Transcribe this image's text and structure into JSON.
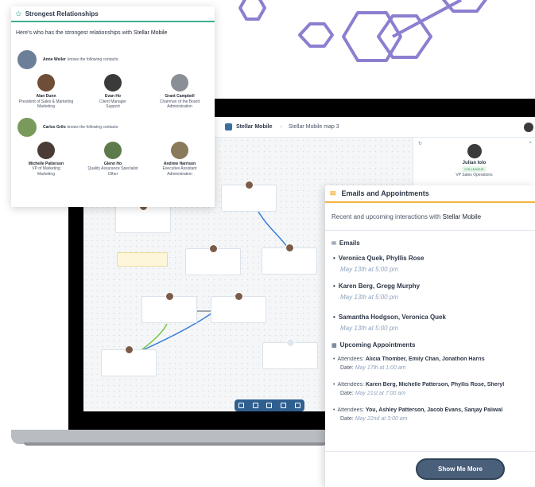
{
  "relationships": {
    "title": "Strongest Relationships",
    "intro_prefix": "Here's who has the strongest relationships with ",
    "company": "Stellar Mobile",
    "knows_suffix": "knows the following contacts:",
    "groups": [
      {
        "name": "Anne Weiler",
        "contacts": [
          {
            "name": "Alan Dunn",
            "title": "President of Sales & Marketing",
            "dept": "Marketing"
          },
          {
            "name": "Evan Ho",
            "title": "Client Manager",
            "dept": "Support"
          },
          {
            "name": "Grant Campbell",
            "title": "Chairman of the Board",
            "dept": "Administration"
          }
        ]
      },
      {
        "name": "Carlos Grilo",
        "contacts": [
          {
            "name": "Michelle Patterson",
            "title": "VP of Marketing",
            "dept": "Marketing"
          },
          {
            "name": "Glenn Ho",
            "title": "Quality Assurance Specialist",
            "dept": "Other"
          },
          {
            "name": "Andrew Harrison",
            "title": "Executive Assistant",
            "dept": "Administration"
          }
        ]
      }
    ]
  },
  "app": {
    "title": "Stellar Mobile",
    "map_name": "Stellar Mobile map 3",
    "profile": {
      "name": "Julian Iolo",
      "badge": "COLLEAGUE",
      "role": "VP Sales Operations"
    }
  },
  "emails_panel": {
    "title": "Emails and Appointments",
    "subtitle_prefix": "Recent and upcoming interactions with ",
    "company": "Stellar Mobile",
    "emails_title": "Emails",
    "emails": [
      {
        "names": "Veronica Quek, Phyllis Rose",
        "date": "May 13th at 5:00 pm"
      },
      {
        "names": "Karen Berg, Gregg Murphy",
        "date": "May 13th at 5:00 pm"
      },
      {
        "names": "Samantha Hodgson, Veronica Quek",
        "date": "May 13th at 5:00 pm"
      }
    ],
    "appointments_title": "Upcoming Appointments",
    "attendees_label": "Attendees:",
    "date_label": "Date:",
    "appointments": [
      {
        "attendees": "Alicia Thomber, Emily Chan, Jonathon Harris",
        "date": "May 17th at 1:00 am"
      },
      {
        "attendees": "Karen Berg, Michelle Patterson, Phyllis Rose, Sheryl",
        "date": "May 21st at 7:00 am"
      },
      {
        "attendees": "You, Ashley Patterson, Jacob Evans, Sanjay Paliwal",
        "date": "May 22nd at 3:00 am"
      }
    ],
    "show_more_label": "Show Me More"
  },
  "colors": {
    "relationships_accent": "#3bb08f",
    "emails_accent": "#f6b53c",
    "button": "#4a5f7a"
  }
}
